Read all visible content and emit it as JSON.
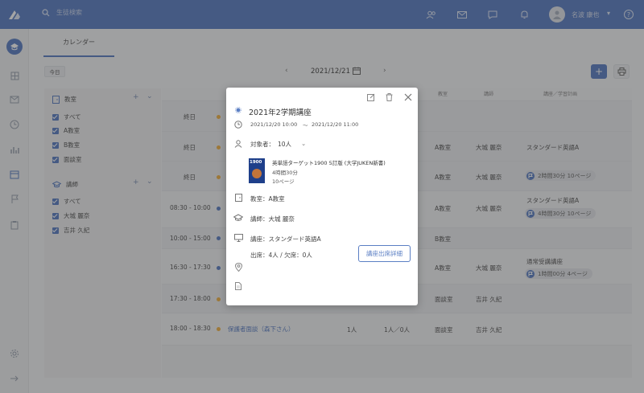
{
  "header": {
    "search_placeholder": "生徒検索",
    "user_name": "名波 康也",
    "user_caret": "▾",
    "help_symbol": "?"
  },
  "tabs": [
    {
      "label": "カレンダー",
      "active": true
    }
  ],
  "toolbar": {
    "today_label": "今日",
    "date": "2021/12/21",
    "prev_symbol": "‹",
    "next_symbol": "›",
    "add_symbol": "+"
  },
  "filter": {
    "classrooms": {
      "title": "教室",
      "add_symbol": "+",
      "caret": "⌄",
      "items": [
        "すべて",
        "A教室",
        "B教室",
        "面談室"
      ]
    },
    "teachers": {
      "title": "講師",
      "add_symbol": "+",
      "caret": "⌄",
      "items": [
        "すべて",
        "大城 麗奈",
        "吉井 久紀"
      ]
    }
  },
  "grid": {
    "headers": [
      "教室",
      "講師",
      "講座／学習計画"
    ],
    "rows": [
      {
        "time": "終日",
        "room": "",
        "teacher": "",
        "plan": "",
        "dot": "orange"
      },
      {
        "time": "終日",
        "room": "A教室",
        "teacher": "大城 麗奈",
        "plan": "スタンダード英語A",
        "dot": "orange"
      },
      {
        "time": "終日",
        "room": "A教室",
        "teacher": "大城 麗奈",
        "plan": "",
        "pill": "2時間30分  10ページ",
        "dot": "orange"
      },
      {
        "time": "08:30 - 10:00",
        "room": "A教室",
        "teacher": "大城 麗奈",
        "plan": "スタンダード英語A",
        "pill": "4時間30分  10ページ",
        "dot": "blue"
      },
      {
        "time": "10:00 - 15:00",
        "room": "B教室",
        "teacher": "",
        "plan": "",
        "dot": "blue"
      },
      {
        "time": "16:30 - 17:30",
        "room": "A教室",
        "teacher": "大城 麗奈",
        "plan": "通常受講講座",
        "pill": "1時間00分  4ページ",
        "dot": "blue"
      },
      {
        "time": "17:30 - 18:00",
        "room": "面談室",
        "teacher": "吉井 久紀",
        "plan": "",
        "dot": "orange"
      },
      {
        "time": "18:00 - 18:30",
        "event": "保護者面談（森下さん）",
        "count": "1人",
        "attendance": "1人／0人",
        "room": "面談室",
        "teacher": "吉井 久紀",
        "plan": "",
        "dot": "orange"
      }
    ]
  },
  "modal": {
    "title": "2021年2学期講座",
    "start": "2021/12/20   10:00",
    "separator": "〜",
    "end": "2021/12/20   11:00",
    "target_label": "対象者：",
    "target_value": "10人",
    "target_caret": "⌄",
    "book_title": "英単語ターゲット1900 5訂版 (大学JUKEN新書)",
    "book_duration": "4時間30分",
    "book_pages": "10ページ",
    "book_cover_number": "1900",
    "classroom": "教室：A教室",
    "teacher": "講師：大城 麗奈",
    "course": "講座：スタンダード英語A",
    "attendance": "出席：4人 / 欠席：0人",
    "attendance_button": "講座出席詳細",
    "accent_color": "#5b7fc4"
  }
}
